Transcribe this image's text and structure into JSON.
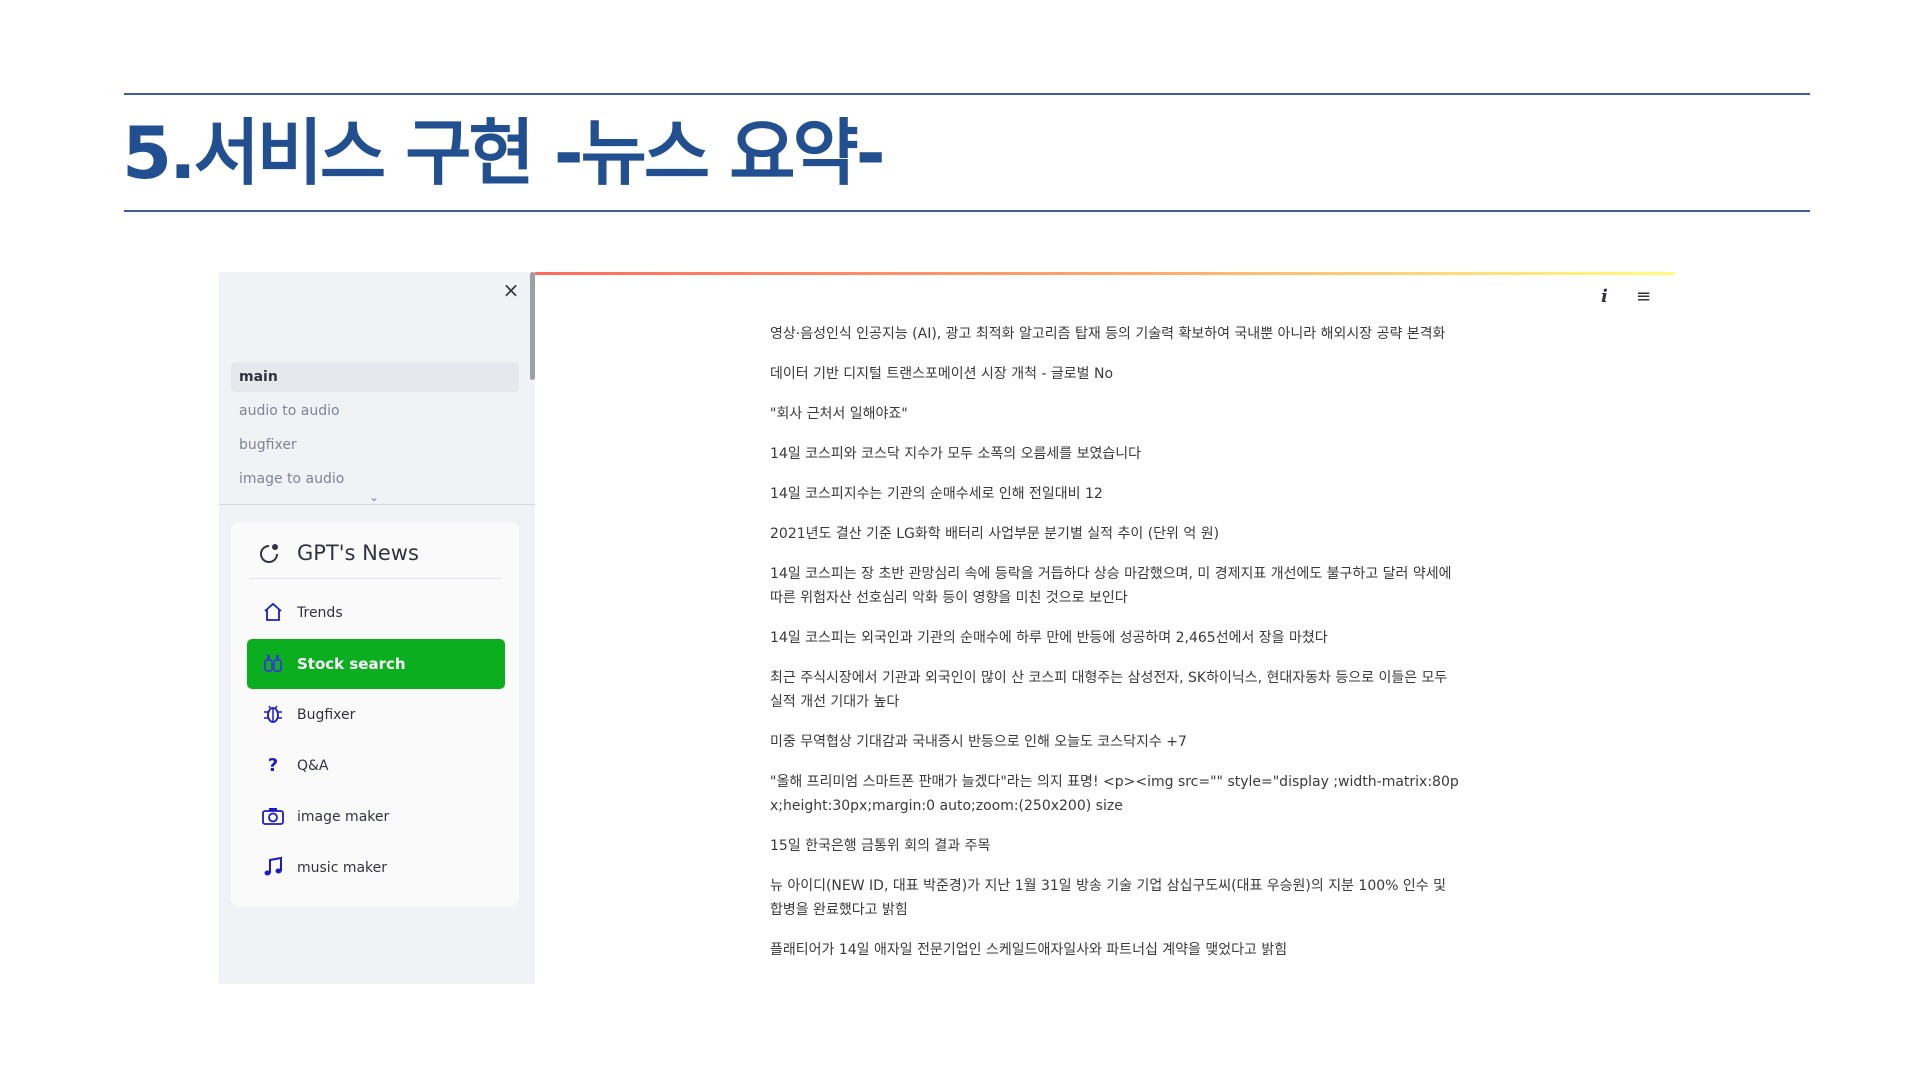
{
  "slide": {
    "title": "5.서비스 구현 -뉴스 요약-"
  },
  "sidebar": {
    "close_symbol": "×",
    "pages": [
      {
        "label": "main",
        "active": true
      },
      {
        "label": "audio to audio",
        "active": false
      },
      {
        "label": "bugfixer",
        "active": false
      },
      {
        "label": "image to audio",
        "active": false
      }
    ],
    "more_symbol": "⌄",
    "menu": {
      "title": "GPT's News",
      "header_icon": "chat-dot-icon",
      "items": [
        {
          "label": "Trends",
          "icon": "house-icon",
          "active": false
        },
        {
          "label": "Stock search",
          "icon": "binoculars-icon",
          "active": true
        },
        {
          "label": "Bugfixer",
          "icon": "bug-icon",
          "active": false
        },
        {
          "label": "Q&A",
          "icon": "question-icon",
          "active": false
        },
        {
          "label": "image maker",
          "icon": "camera-icon",
          "active": false
        },
        {
          "label": "music maker",
          "icon": "music-note-icon",
          "active": false
        }
      ]
    }
  },
  "header": {
    "info_symbol": "i",
    "menu_symbol": "≡"
  },
  "news": [
    "영상·음성인식 인공지능 (AI), 광고 최적화 알고리즘 탑재 등의 기술력 확보하여 국내뿐 아니라 해외시장 공략 본격화",
    "데이터 기반 디지털 트랜스포메이션 시장 개척 - 글로벌 No",
    "\"회사 근처서 일해야죠\"",
    "14일 코스피와 코스닥 지수가 모두 소폭의 오름세를 보였습니다",
    "14일 코스피지수는 기관의 순매수세로 인해 전일대비 12",
    "2021년도 결산 기준 LG화학 배터리 사업부문 분기별 실적 추이 (단위 억 원)",
    "14일 코스피는 장 초반 관망심리 속에 등락을 거듭하다 상승 마감했으며, 미 경제지표 개선에도 불구하고 달러 약세에 따른 위험자산 선호심리 악화 등이 영향을 미친 것으로 보인다",
    "14일 코스피는 외국인과 기관의 순매수에 하루 만에 반등에 성공하며 2,465선에서 장을 마쳤다",
    "최근 주식시장에서 기관과 외국인이 많이 산 코스피 대형주는 삼성전자, SK하이닉스, 현대자동차 등으로 이들은 모두 실적 개선 기대가 높다",
    "미중 무역협상 기대감과 국내증시 반등으로 인해 오늘도 코스닥지수 +7",
    "\"올해 프리미엄 스마트폰 판매가 늘겠다\"라는 의지 표명! <p><img src=\"\" style=\"display ;width-matrix:80px;height:30px;margin:0 auto;zoom:(250x200) size",
    "15일 한국은행 금통위 회의 결과 주목",
    "뉴 아이디(NEW ID, 대표 박준경)가 지난 1월 31일 방송 기술 기업 삼십구도씨(대표 우승원)의 지분 100% 인수 및 합병을 완료했다고 밝힘",
    "플래티어가 14일 애자일 전문기업인 스케일드애자일사와 파트너십 계약을 맺었다고 밝힘"
  ]
}
